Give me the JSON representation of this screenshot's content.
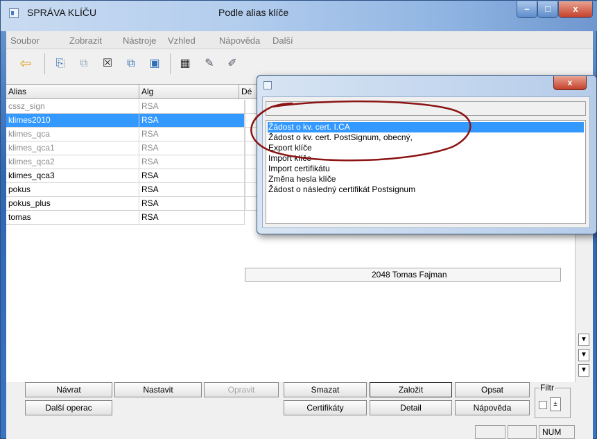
{
  "window": {
    "title": "SPRÁVA KLÍČU",
    "subtitle": "Podle alias klíče",
    "minimize": "–",
    "maximize": "□",
    "close": "x"
  },
  "menu": [
    "Soubor",
    "Zobrazit",
    "Nástroje",
    "Vzhled",
    "Nápověda",
    "Další"
  ],
  "toolbar_icons": [
    "back-arrow-icon",
    "new-item-icon",
    "copy-disabled-icon",
    "delete-icon",
    "copy-icon",
    "view-icon",
    "calculator-icon",
    "certificate-icon",
    "certificate-tool-icon"
  ],
  "grid": {
    "columns": [
      "Alias",
      "Alg",
      "Dé"
    ],
    "rows": [
      {
        "alias": "cssz_sign",
        "alg": "RSA",
        "dim": true
      },
      {
        "alias": "klimes2010",
        "alg": "RSA",
        "selected": true
      },
      {
        "alias": "klimes_qca",
        "alg": "RSA",
        "dim": true
      },
      {
        "alias": "klimes_qca1",
        "alg": "RSA",
        "dim": true
      },
      {
        "alias": "klimes_qca2",
        "alg": "RSA",
        "dim": true
      },
      {
        "alias": "klimes_qca3",
        "alg": "RSA"
      },
      {
        "alias": "pokus",
        "alg": "RSA"
      },
      {
        "alias": "pokus_plus",
        "alg": "RSA"
      },
      {
        "alias": "tomas",
        "alg": "RSA"
      }
    ],
    "last_row_detail": "2048  Tomas Fajman"
  },
  "buttons": {
    "row1": [
      "Návrat",
      "Nastavit",
      "Opravit",
      "Smazat",
      "Založit",
      "Opsat"
    ],
    "row2": [
      "Další operac",
      "Certifikáty",
      "Detail",
      "Nápověda"
    ],
    "filtr": "Filtr",
    "spin": "±"
  },
  "scroll": {
    "down": "▼",
    "page_down": "▼",
    "end": "▼"
  },
  "status": {
    "num": "NUM"
  },
  "dialog": {
    "close": "x",
    "items": [
      "Žádost o kv. cert. I.CA",
      "Žádost o kv. cert. PostSignum, obecný,",
      "Export klíče",
      "Import klíče",
      "Import certifikátu",
      "Změna hesla klíče",
      "Žádost o následný certifikát Postsignum"
    ]
  }
}
